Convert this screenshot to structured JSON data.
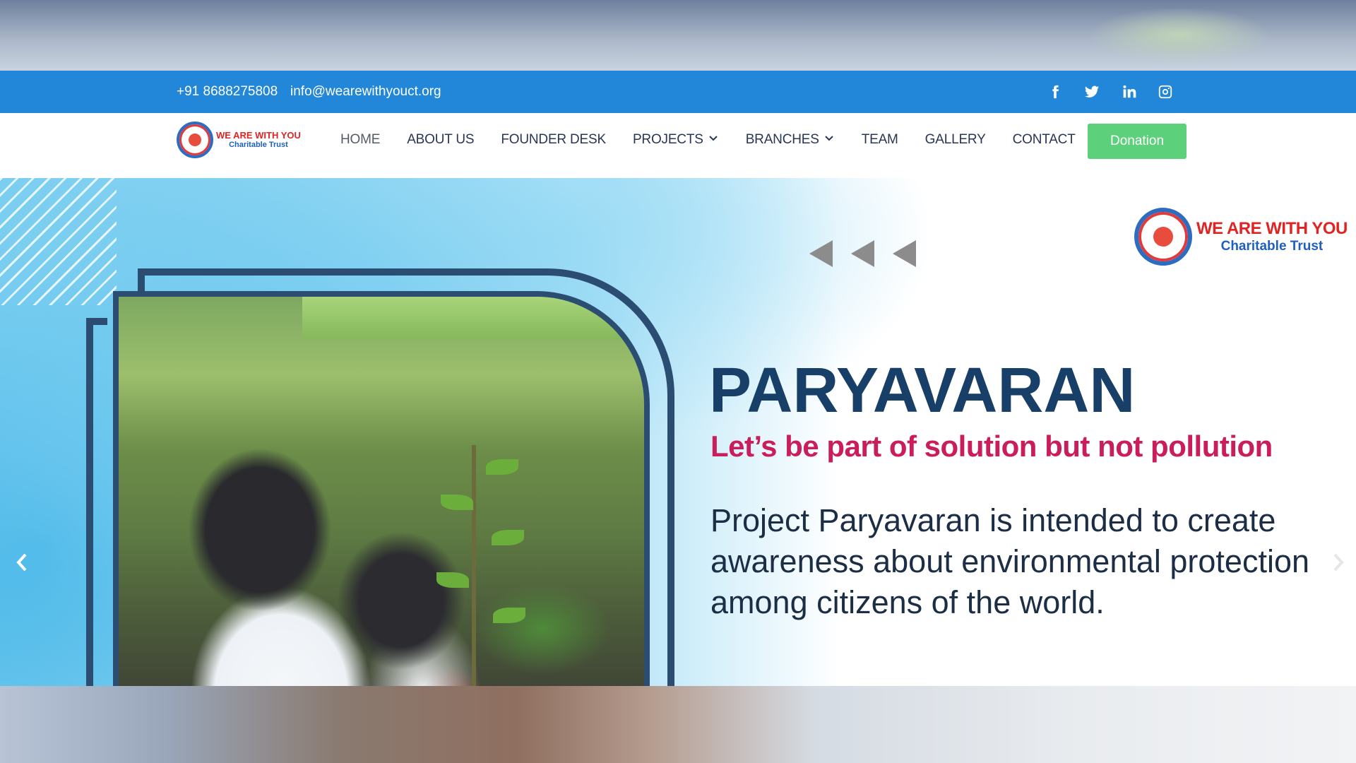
{
  "topbar": {
    "phone": "+91 8688275808",
    "email": "info@wearewithyouct.org",
    "socials": [
      {
        "icon": "facebook-icon"
      },
      {
        "icon": "twitter-icon"
      },
      {
        "icon": "linkedin-icon"
      },
      {
        "icon": "instagram-icon"
      }
    ]
  },
  "logo": {
    "line1": "WE ARE WITH YOU",
    "line2": "Charitable Trust"
  },
  "nav": {
    "items": [
      {
        "label": "HOME"
      },
      {
        "label": "ABOUT US"
      },
      {
        "label": "FOUNDER DESK"
      },
      {
        "label": "PROJECTS"
      },
      {
        "label": "BRANCHES"
      },
      {
        "label": "TEAM"
      },
      {
        "label": "GALLERY"
      },
      {
        "label": "CONTACT"
      }
    ],
    "donate_label": "Donation"
  },
  "hero": {
    "title": "PARYAVARAN",
    "subtitle": "Let’s be part of solution but not pollution",
    "description": "Project Paryavaran is intended to create awareness about environmental protection among citizens of the world.",
    "logo_line1": "WE ARE WITH YOU",
    "logo_line2": "Charitable Trust"
  },
  "colors": {
    "topbar": "#2287d8",
    "donate": "#5cd07a",
    "title": "#173f67",
    "subtitle": "#c91e5b"
  }
}
